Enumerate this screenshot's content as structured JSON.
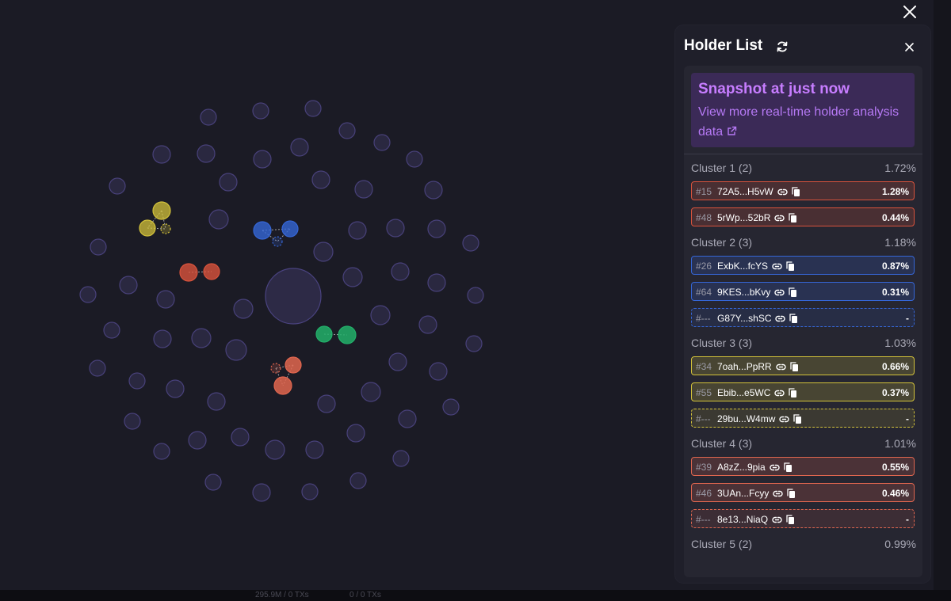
{
  "panel": {
    "title": "Holder List",
    "snapshot": {
      "title": "Snapshot at just now",
      "link_text": "View more real-time holder analysis data"
    },
    "clusters": [
      {
        "label": "Cluster 1 (2)",
        "percent": "1.72%",
        "color": "#d9533c",
        "rows": [
          {
            "rank": "#15",
            "address": "72A5...H5vW",
            "share": "1.28%",
            "dashed": false
          },
          {
            "rank": "#48",
            "address": "5rWp...52bR",
            "share": "0.44%",
            "dashed": false
          }
        ]
      },
      {
        "label": "Cluster 2 (3)",
        "percent": "1.18%",
        "color": "#3566d6",
        "rows": [
          {
            "rank": "#26",
            "address": "ExbK...fcYS",
            "share": "0.87%",
            "dashed": false
          },
          {
            "rank": "#64",
            "address": "9KES...bKvy",
            "share": "0.31%",
            "dashed": false
          },
          {
            "rank": "#---",
            "address": "G87Y...shSC",
            "share": "-",
            "dashed": true
          }
        ]
      },
      {
        "label": "Cluster 3 (3)",
        "percent": "1.03%",
        "color": "#d3c23a",
        "rows": [
          {
            "rank": "#34",
            "address": "7oah...PpRR",
            "share": "0.66%",
            "dashed": false
          },
          {
            "rank": "#55",
            "address": "Ebib...e5WC",
            "share": "0.37%",
            "dashed": false
          },
          {
            "rank": "#---",
            "address": "29bu...W4mw",
            "share": "-",
            "dashed": true
          }
        ]
      },
      {
        "label": "Cluster 4 (3)",
        "percent": "1.01%",
        "color": "#e0664f",
        "rows": [
          {
            "rank": "#39",
            "address": "A8zZ...9pia",
            "share": "0.55%",
            "dashed": false
          },
          {
            "rank": "#46",
            "address": "3UAn...Fcyy",
            "share": "0.46%",
            "dashed": false
          },
          {
            "rank": "#---",
            "address": "8e13...NiaQ",
            "share": "-",
            "dashed": true
          }
        ]
      },
      {
        "label": "Cluster 5 (2)",
        "percent": "0.99%",
        "color": "#22b06a",
        "rows": []
      }
    ]
  },
  "bottom_bar": {
    "left_text": "295.9M / 0 TXs",
    "right_text": "0 / 0 TXs"
  },
  "colors": {
    "background": "#1b1b25",
    "panel": "#1f1f2a",
    "bubble_fill": "#2a2840",
    "bubble_stroke": "#48417a",
    "accent_purple": "#c77dff"
  },
  "icons": {
    "close": "close-icon",
    "refresh": "refresh-icon",
    "external_link": "external-link-icon",
    "link": "link-icon",
    "copy": "copy-icon"
  }
}
